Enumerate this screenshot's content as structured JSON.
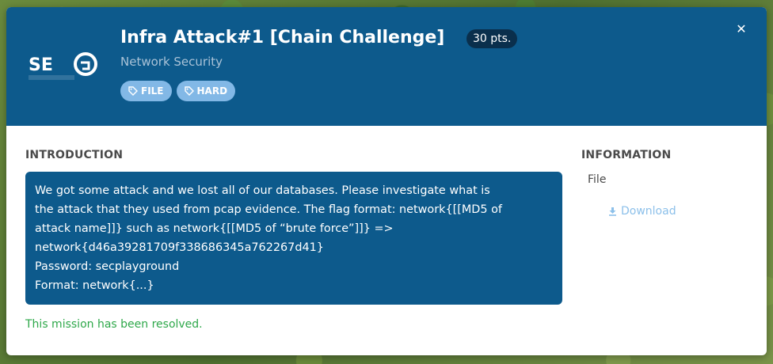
{
  "challenge": {
    "title": "Infra Attack#1 [Chain Challenge]",
    "points": "30 pts.",
    "category": "Network Security",
    "tags": [
      {
        "label": "FILE",
        "icon": "tag-icon"
      },
      {
        "label": "HARD",
        "icon": "tag-icon"
      }
    ]
  },
  "logo": {
    "text": "SECPLAYGROUND"
  },
  "close": {
    "icon": "close-icon",
    "glyph": "✕"
  },
  "introduction": {
    "heading": "INTRODUCTION",
    "lines": [
      "We got some attack and we lost all of our databases. Please investigate what is",
      "the attack that they used from pcap evidence. The flag format: network{[[MD5 of",
      "attack name]]} such as network{[[MD5 of “brute force”]]} =>",
      "network{d46a39281709f338686345a762267d41}",
      "Password: secplayground",
      "Format: network{...}"
    ]
  },
  "status": {
    "resolved_text": "This mission has been resolved."
  },
  "information": {
    "heading": "INFORMATION",
    "file_label": "File",
    "download_label": "Download",
    "download_icon": "download-icon"
  },
  "colors": {
    "header_bg": "#0d5a8c",
    "points_badge_bg": "#0a2f4c",
    "tag_bg": "#82b8e6",
    "resolved_text": "#2ea84a",
    "download_link": "#8cc0ea"
  }
}
